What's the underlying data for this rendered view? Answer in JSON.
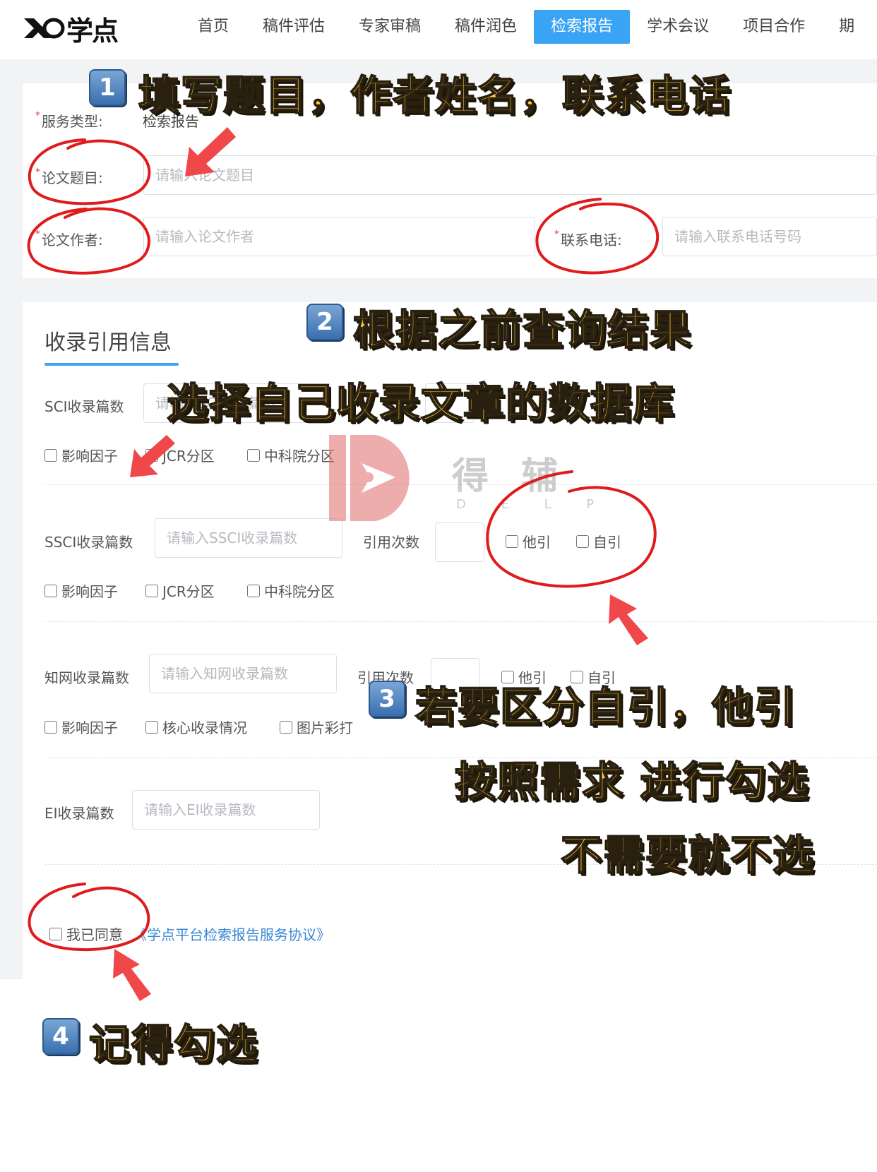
{
  "header": {
    "logo_text": "学点",
    "nav": [
      "首页",
      "稿件评估",
      "专家审稿",
      "稿件润色",
      "检索报告",
      "学术会议",
      "项目合作",
      "期"
    ],
    "active_nav": "检索报告"
  },
  "form": {
    "service_type_label": "服务类型:",
    "service_type_value": "检索报告",
    "title_label": "论文题目:",
    "title_placeholder": "请输入论文题目",
    "author_label": "论文作者:",
    "author_placeholder": "请输入论文作者",
    "phone_label": "联系电话:",
    "phone_placeholder": "请输入联系电话号码",
    "required_mark": "*"
  },
  "citation": {
    "section_title": "收录引用信息",
    "sci": {
      "label": "SCI收录篇数",
      "input_placeholder": "请输入SCI收录篇数",
      "options": [
        "影响因子",
        "JCR分区",
        "中科院分区"
      ]
    },
    "ssci": {
      "label": "SSCI收录篇数",
      "input_placeholder": "请输入SSCI收录篇数",
      "cite_label": "引用次数",
      "cite_options": [
        "他引",
        "自引"
      ],
      "options": [
        "影响因子",
        "JCR分区",
        "中科院分区"
      ]
    },
    "cnki": {
      "label": "知网收录篇数",
      "input_placeholder": "请输入知网收录篇数",
      "cite_label": "引用次数",
      "cite_options": [
        "他引",
        "自引"
      ],
      "options": [
        "影响因子",
        "核心收录情况",
        "图片彩打"
      ]
    },
    "ei": {
      "label": "EI收录篇数",
      "input_placeholder": "请输入EI收录篇数"
    },
    "agree_text": "我已同意",
    "agree_link": "《学点平台检索报告服务协议》"
  },
  "watermark": {
    "text": "得 辅",
    "sub": "D E L P"
  },
  "annotations": {
    "step1": {
      "num": "1",
      "text": "填写题目，作者姓名，联系电话"
    },
    "step2": {
      "num": "2",
      "line1": "根据之前查询结果",
      "line2": "选择自己收录文章的数据库"
    },
    "step3": {
      "num": "3",
      "line1": "若要区分自引，他引",
      "line2": "按照需求 进行勾选",
      "line3": "不需要就不选"
    },
    "step4": {
      "num": "4",
      "text": "记得勾选"
    }
  },
  "colors": {
    "accent": "#3aa4f4",
    "annotation_fill": "#ffcf3a",
    "circle_red": "#e01b1b",
    "arrow_red": "#f0484a",
    "link": "#3a88d6"
  }
}
